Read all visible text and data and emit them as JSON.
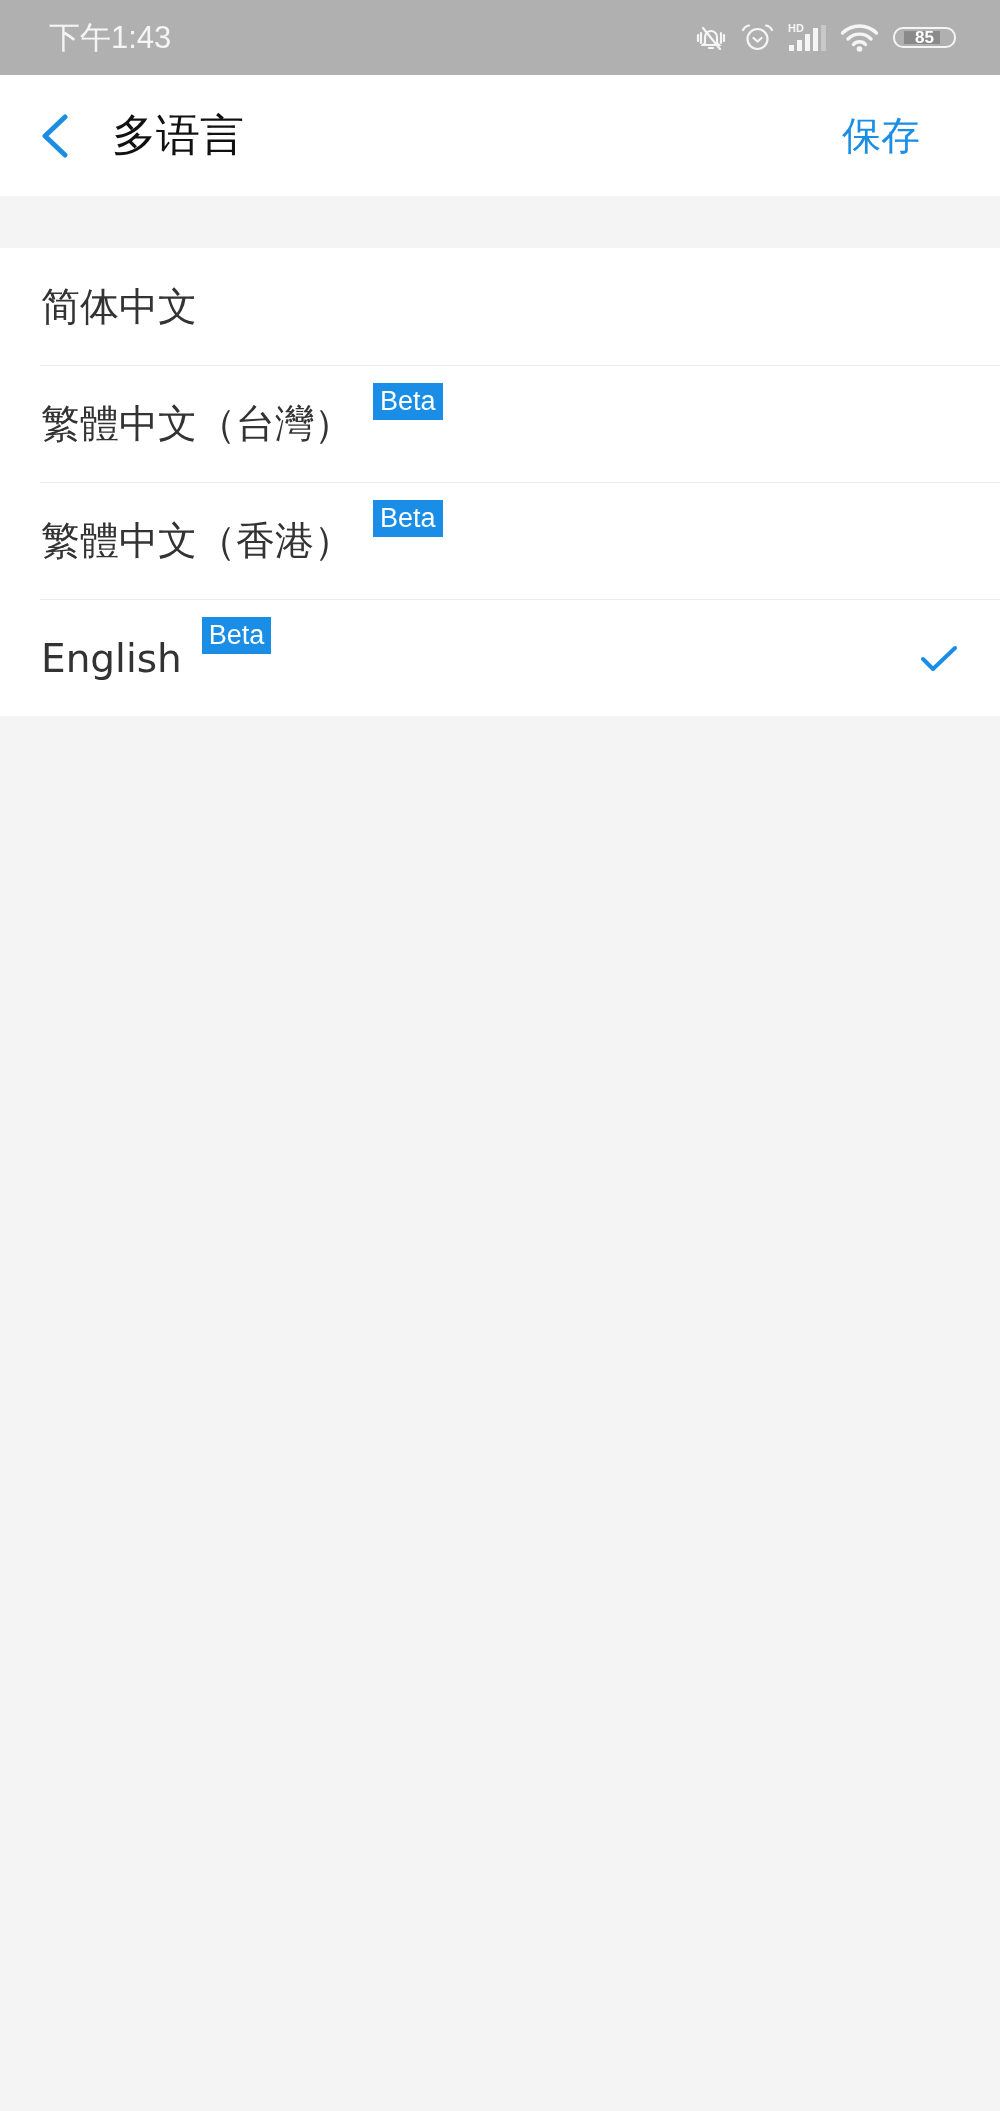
{
  "status_bar": {
    "time": "下午1:43",
    "network": "HD",
    "battery": "85"
  },
  "header": {
    "title": "多语言",
    "action": "保存"
  },
  "languages": [
    {
      "label": "简体中文",
      "selected": false
    },
    {
      "label": "繁體中文（台灣）",
      "badge": "Beta",
      "selected": false
    },
    {
      "label": "繁體中文（香港）",
      "badge": "Beta",
      "selected": false
    },
    {
      "label": "English",
      "badge": "Beta",
      "selected": true
    }
  ]
}
